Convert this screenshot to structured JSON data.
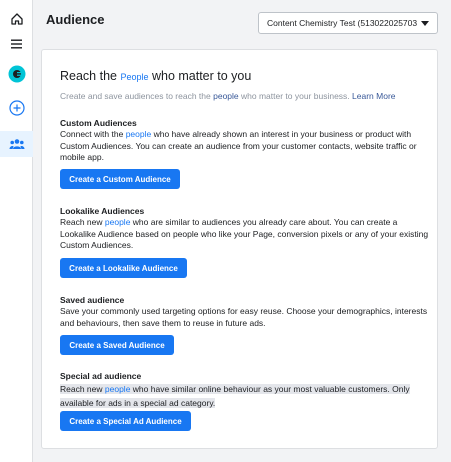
{
  "page": {
    "title": "Audience"
  },
  "account": {
    "selected": "Content Chemistry Test (513022025703"
  },
  "sidebar": {
    "icons": [
      "home-icon",
      "menu-icon",
      "account-avatar-icon",
      "add-icon",
      "audiences-icon"
    ]
  },
  "intro": {
    "headline_prefix": "Reach the ",
    "headline_highlight": "People",
    "headline_suffix": " who matter to you",
    "sub_prefix": "Create and save audiences to reach the ",
    "sub_highlight": "people",
    "sub_suffix": " who matter to your business.",
    "learn_more": "Learn More"
  },
  "sections": {
    "custom": {
      "title": "Custom Audiences",
      "body_a": "Connect with the ",
      "body_hl": "people",
      "body_b": " who have already shown an interest in your business or product with Custom Audiences. You can create an audience from your customer contacts, website traffic or mobile app.",
      "button": "Create a Custom Audience"
    },
    "lookalike": {
      "title": "Lookalike Audiences",
      "body_a": "Reach new ",
      "body_hl": "people",
      "body_b": " who are similar to audiences you already care about. You can create a Lookalike Audience based on people who like your Page, conversion pixels or any of your existing Custom Audiences.",
      "button": "Create a Lookalike Audience"
    },
    "saved": {
      "title": "Saved audience",
      "body": "Save your commonly used targeting options for easy reuse. Choose your demographics, interests and behaviours, then save them to reuse in future ads.",
      "button": "Create a Saved Audience"
    },
    "special": {
      "title": "Special ad audience",
      "body_a": "Reach new ",
      "body_hl": "people",
      "body_b": " who have similar online behaviour as your most valuable customers. Only available for ads in a special ad category.",
      "button": "Create a Special Ad Audience"
    }
  },
  "colors": {
    "accent": "#1877f2",
    "avatar": "#00c4d6"
  }
}
